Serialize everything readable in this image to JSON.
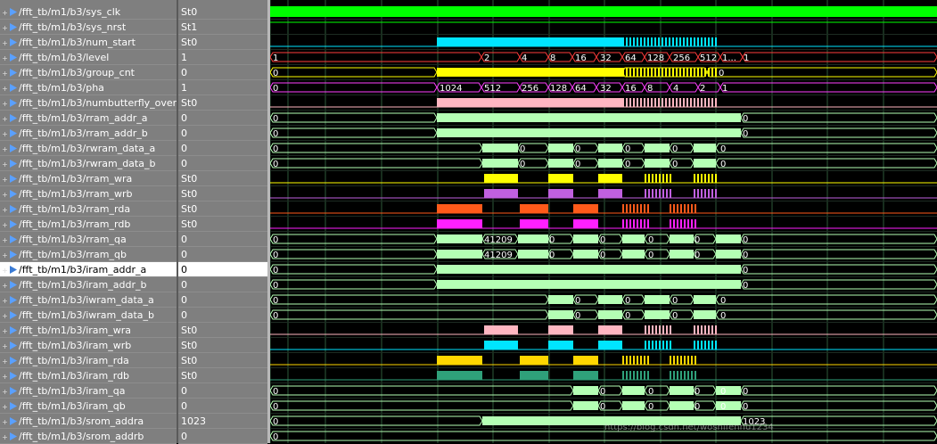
{
  "signals": [
    {
      "name": "/fft_tb/m1/b3/sys_clk",
      "value": "St0",
      "color": "#00ff00",
      "kind": "clk"
    },
    {
      "name": "/fft_tb/m1/b3/sys_nrst",
      "value": "St1",
      "color": "#00ff00",
      "kind": "line"
    },
    {
      "name": "/fft_tb/m1/b3/num_start",
      "value": "St0",
      "color": "#00e5ff",
      "kind": "bit"
    },
    {
      "name": "/fft_tb/m1/b3/level",
      "value": "1",
      "color": "#ff3b3b",
      "kind": "bus",
      "labels": [
        "1",
        "2",
        "4",
        "8",
        "16",
        "32",
        "64",
        "128",
        "256",
        "512",
        "1...",
        "1"
      ]
    },
    {
      "name": "/fft_tb/m1/b3/group_cnt",
      "value": "0",
      "color": "#ffff00",
      "kind": "bus",
      "labels": [
        "0",
        "0"
      ]
    },
    {
      "name": "/fft_tb/m1/b3/pha",
      "value": "1",
      "color": "#ff40ff",
      "kind": "bus",
      "labels": [
        "0",
        "1024",
        "512",
        "256",
        "128",
        "64",
        "32",
        "16",
        "8",
        "4",
        "2",
        "1"
      ]
    },
    {
      "name": "/fft_tb/m1/b3/numbutterfly_over",
      "value": "St0",
      "color": "#ffb6c1",
      "kind": "bit"
    },
    {
      "name": "/fft_tb/m1/b3/rram_addr_a",
      "value": "0",
      "color": "#b4ffb4",
      "kind": "bus",
      "labels": [
        "0",
        "0"
      ]
    },
    {
      "name": "/fft_tb/m1/b3/rram_addr_b",
      "value": "0",
      "color": "#b4ffb4",
      "kind": "bus",
      "labels": [
        "0",
        "0"
      ]
    },
    {
      "name": "/fft_tb/m1/b3/rwram_data_a",
      "value": "0",
      "color": "#b4ffb4",
      "kind": "bus",
      "labels": [
        "0",
        "0",
        "0",
        "0",
        "0",
        "0"
      ]
    },
    {
      "name": "/fft_tb/m1/b3/rwram_data_b",
      "value": "0",
      "color": "#b4ffb4",
      "kind": "bus",
      "labels": [
        "0",
        "0",
        "0",
        "0",
        "0",
        "0"
      ]
    },
    {
      "name": "/fft_tb/m1/b3/rram_wra",
      "value": "St0",
      "color": "#ffff00",
      "kind": "bit"
    },
    {
      "name": "/fft_tb/m1/b3/rram_wrb",
      "value": "St0",
      "color": "#c060e0",
      "kind": "bit"
    },
    {
      "name": "/fft_tb/m1/b3/rram_rda",
      "value": "St0",
      "color": "#ff5a1a",
      "kind": "bit"
    },
    {
      "name": "/fft_tb/m1/b3/rram_rdb",
      "value": "St0",
      "color": "#ff20ff",
      "kind": "bit"
    },
    {
      "name": "/fft_tb/m1/b3/rram_qa",
      "value": "0",
      "color": "#b4ffb4",
      "kind": "bus",
      "labels": [
        "0",
        "41209",
        "0",
        "0",
        "0",
        "0",
        "0"
      ]
    },
    {
      "name": "/fft_tb/m1/b3/rram_qb",
      "value": "0",
      "color": "#b4ffb4",
      "kind": "bus",
      "labels": [
        "0",
        "41209",
        "0",
        "0",
        "0",
        "0",
        "0"
      ]
    },
    {
      "name": "/fft_tb/m1/b3/iram_addr_a",
      "value": "0",
      "color": "#b4ffb4",
      "kind": "bus",
      "labels": [
        "0",
        "0"
      ],
      "selected": true
    },
    {
      "name": "/fft_tb/m1/b3/iram_addr_b",
      "value": "0",
      "color": "#b4ffb4",
      "kind": "bus",
      "labels": [
        "0",
        "0"
      ]
    },
    {
      "name": "/fft_tb/m1/b3/iwram_data_a",
      "value": "0",
      "color": "#b4ffb4",
      "kind": "bus",
      "labels": [
        "0",
        "0",
        "0",
        "0",
        "0"
      ]
    },
    {
      "name": "/fft_tb/m1/b3/iwram_data_b",
      "value": "0",
      "color": "#b4ffb4",
      "kind": "bus",
      "labels": [
        "0",
        "0",
        "0",
        "0",
        "0"
      ]
    },
    {
      "name": "/fft_tb/m1/b3/iram_wra",
      "value": "St0",
      "color": "#ffb6c1",
      "kind": "bit"
    },
    {
      "name": "/fft_tb/m1/b3/iram_wrb",
      "value": "St0",
      "color": "#00e5ff",
      "kind": "bit"
    },
    {
      "name": "/fft_tb/m1/b3/iram_rda",
      "value": "St0",
      "color": "#ffd700",
      "kind": "bit"
    },
    {
      "name": "/fft_tb/m1/b3/iram_rdb",
      "value": "St0",
      "color": "#2fa07a",
      "kind": "bit"
    },
    {
      "name": "/fft_tb/m1/b3/iram_qa",
      "value": "0",
      "color": "#b4ffb4",
      "kind": "bus",
      "labels": [
        "0",
        "0",
        "0",
        "0",
        "0",
        "0"
      ]
    },
    {
      "name": "/fft_tb/m1/b3/iram_qb",
      "value": "0",
      "color": "#b4ffb4",
      "kind": "bus",
      "labels": [
        "0",
        "0",
        "0",
        "0",
        "0",
        "0"
      ]
    },
    {
      "name": "/fft_tb/m1/b3/srom_addra",
      "value": "1023",
      "color": "#b4ffb4",
      "kind": "bus",
      "labels": [
        "0",
        "1023"
      ]
    },
    {
      "name": "/fft_tb/m1/b3/srom_addrb",
      "value": "0",
      "color": "#b4ffb4",
      "kind": "bus",
      "labels": [
        "0"
      ]
    }
  ],
  "watermark": "https://blog.csdn.net/woshifennu1234",
  "colors": {
    "panel": "#7f7f7f",
    "wave_bg": "#000000",
    "grid": "#2e5a3a",
    "selected_row": "#ffffff"
  }
}
